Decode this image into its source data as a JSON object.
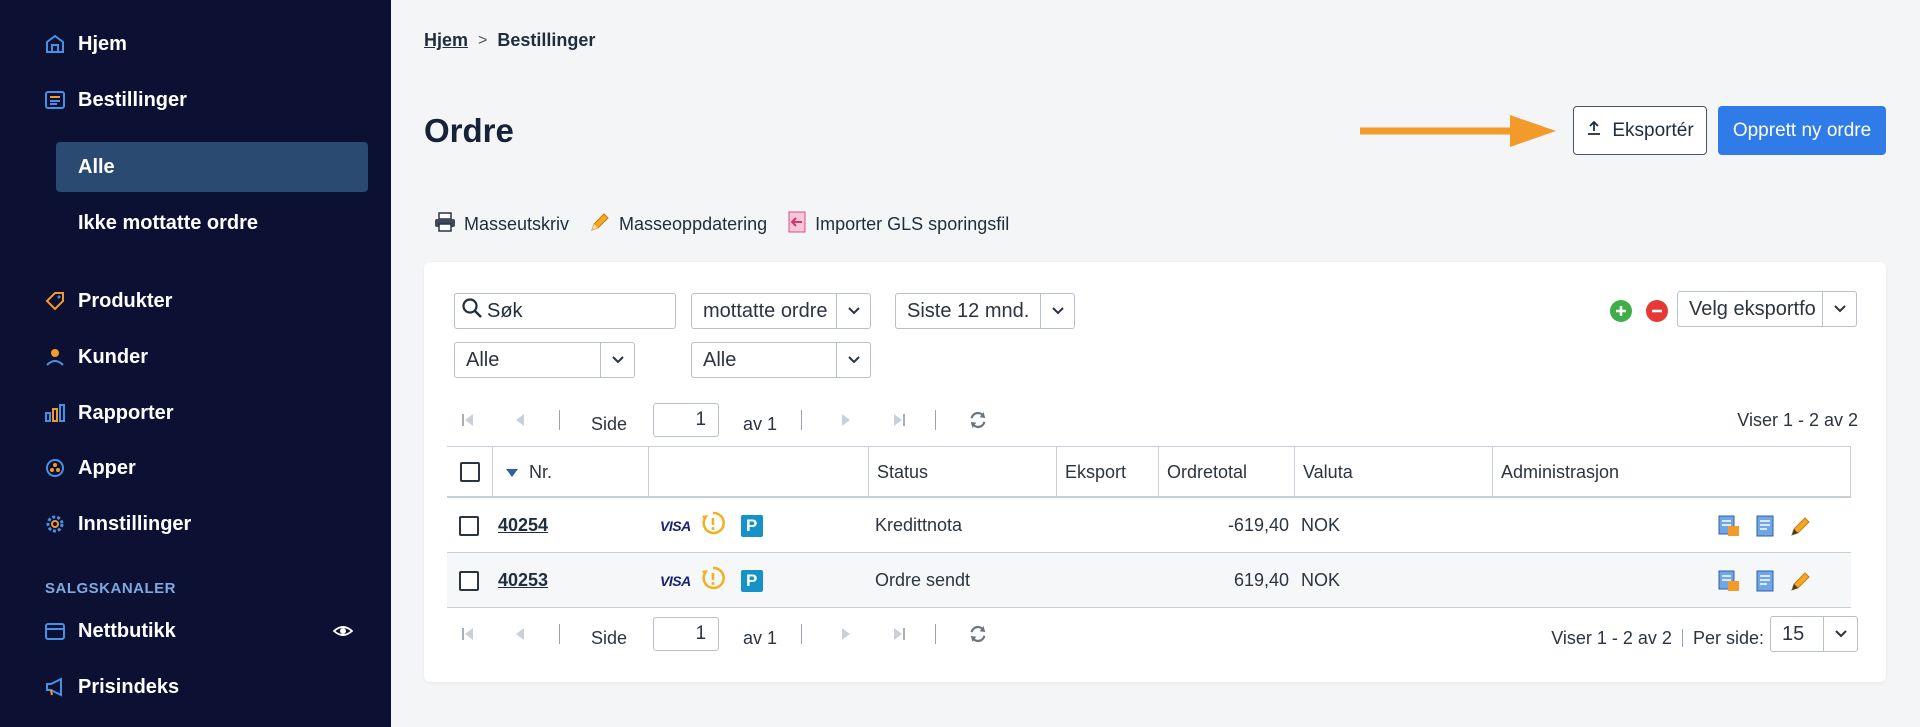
{
  "sidebar": {
    "items": [
      {
        "label": "Hjem",
        "icon": "home-icon"
      },
      {
        "label": "Bestillinger",
        "icon": "orders-icon"
      },
      {
        "label": "Produkter",
        "icon": "tag-icon"
      },
      {
        "label": "Kunder",
        "icon": "user-icon"
      },
      {
        "label": "Rapporter",
        "icon": "bar-chart-icon"
      },
      {
        "label": "Apper",
        "icon": "apps-icon"
      },
      {
        "label": "Innstillinger",
        "icon": "gear-icon"
      }
    ],
    "sub_items": [
      {
        "label": "Alle",
        "active": true
      },
      {
        "label": "Ikke mottatte ordre",
        "active": false
      }
    ],
    "section_label": "SALGSKANALER",
    "channels": [
      {
        "label": "Nettbutikk",
        "icon": "store-icon"
      },
      {
        "label": "Prisindeks",
        "icon": "megaphone-icon"
      }
    ]
  },
  "breadcrumb": {
    "home": "Hjem",
    "separator": ">",
    "current": "Bestillinger"
  },
  "page_title": "Ordre",
  "header_buttons": {
    "export": "Eksportér",
    "create": "Opprett ny ordre"
  },
  "toolbar": {
    "print": "Masseutskriv",
    "mass_update": "Masseoppdatering",
    "import_gls": "Importer GLS sporingsfil"
  },
  "filters": {
    "search_value": "Søk",
    "status_select": "mottatte ordre",
    "period_select": "Siste 12 mnd.",
    "export_format_select": "Velg eksportfo",
    "filter_a": "Alle",
    "filter_b": "Alle"
  },
  "pager_top": {
    "page_label": "Side",
    "page_value": "1",
    "of_label": "av 1",
    "showing": "Viser 1 - 2 av 2"
  },
  "pager_bottom": {
    "page_label": "Side",
    "page_value": "1",
    "of_label": "av 1",
    "showing": "Viser 1 - 2 av 2",
    "per_page_label": "Per side:",
    "per_page_value": "15"
  },
  "table": {
    "columns": [
      "Nr.",
      "",
      "Status",
      "Eksport",
      "Ordretotal",
      "Valuta",
      "Administrasjon"
    ],
    "rows": [
      {
        "nr": "40254",
        "payment": "VISA",
        "status": "Kredittnota",
        "export": "",
        "total": "-619,40",
        "currency": "NOK"
      },
      {
        "nr": "40253",
        "payment": "VISA",
        "status": "Ordre sendt",
        "export": "",
        "total": "619,40",
        "currency": "NOK"
      }
    ]
  },
  "colors": {
    "sidebar_bg": "#0c1033",
    "accent": "#2f7be8",
    "arrow": "#f29b2a",
    "add_green": "#3fae49",
    "remove_red": "#e53935"
  }
}
